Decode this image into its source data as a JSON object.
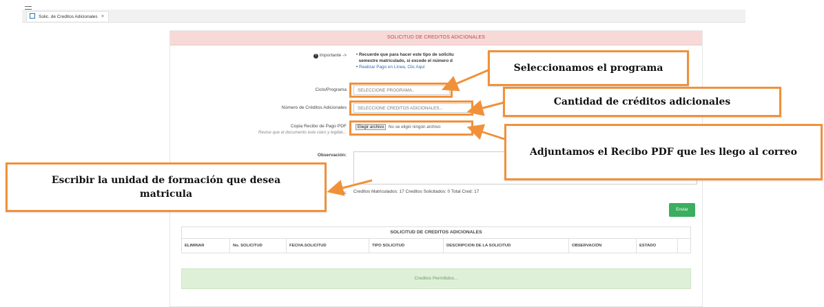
{
  "tab": {
    "label": "Solic. de Creditos Adicionales",
    "close": "×"
  },
  "form": {
    "title": "SOLICITUD DE CREDITOS ADICIONALES",
    "important_label": "Importante ->",
    "important_line1": "Recuerde que para hacer este tipo de solicitu",
    "important_line2": "semestre matriculado, si excede el número d",
    "payment_link": "Realizar Pago en Línea, Clic Aquí",
    "program_label": "Ciclo/Programa",
    "program_value": "SELECCIONE PROGRAMA..",
    "credits_label": "Número de Créditos Adicionales",
    "credits_value": "SELECCIONE CREDITOS ADICIONALES...",
    "receipt_label": "Copia Recibo de Pago PDF",
    "receipt_hint": "Revise que el documento este claro y legible...",
    "file_button": "Elegir archivo",
    "file_status": "No se eligió ningún archivo",
    "observation_label": "Observación:",
    "credits_summary_label": "itos:",
    "credits_summary": "Creditos Matriculados: 17 Creditos Solicitados: 0 Total Cred: 17",
    "send_button": "Enviar"
  },
  "table": {
    "title": "SOLICITUD DE CREDITOS ADICIONALES",
    "columns": [
      "ELIMINAR",
      "No. SOLICITUD",
      "FECHA.SOLICITUD",
      "TIPO SOLICITUD",
      "DESCRIPCION DE LA SOLICITUD",
      "OBSERVACIÓN",
      "ESTADO"
    ]
  },
  "allowed_text": "Creditos Permitidos...",
  "callouts": {
    "program": "Seleccionamos el programa",
    "credits": "Cantidad de créditos adicionales",
    "receipt": "Adjuntamos el Recibo PDF que les llego al correo",
    "observation": "Escribir la unidad de formación que desea matricula"
  },
  "colors": {
    "accent": "#f0913a",
    "header_bg": "#f7d9d8",
    "header_text": "#b44a47",
    "send_button": "#3bae5f",
    "allowed_bg": "#dff0d8"
  }
}
